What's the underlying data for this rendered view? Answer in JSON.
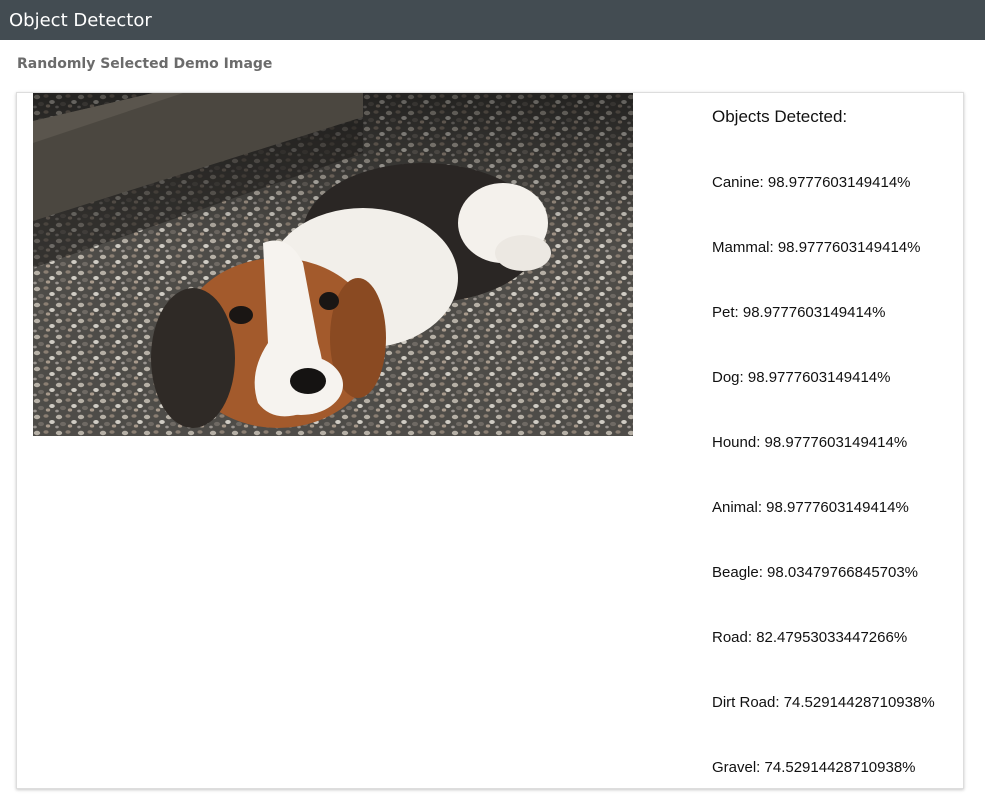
{
  "header": {
    "title": "Object Detector"
  },
  "section": {
    "title": "Randomly Selected Demo Image"
  },
  "image": {
    "subject": "beagle-puppy-on-gravel"
  },
  "results": {
    "heading": "Objects Detected:",
    "items": [
      {
        "text": "Canine: 98.9777603149414%"
      },
      {
        "text": "Mammal: 98.9777603149414%"
      },
      {
        "text": "Pet: 98.9777603149414%"
      },
      {
        "text": "Dog: 98.9777603149414%"
      },
      {
        "text": "Hound: 98.9777603149414%"
      },
      {
        "text": "Animal: 98.9777603149414%"
      },
      {
        "text": "Beagle: 98.03479766845703%"
      },
      {
        "text": "Road: 82.47953033447266%"
      },
      {
        "text": "Dirt Road: 74.52914428710938%"
      },
      {
        "text": "Gravel: 74.52914428710938%"
      }
    ]
  }
}
